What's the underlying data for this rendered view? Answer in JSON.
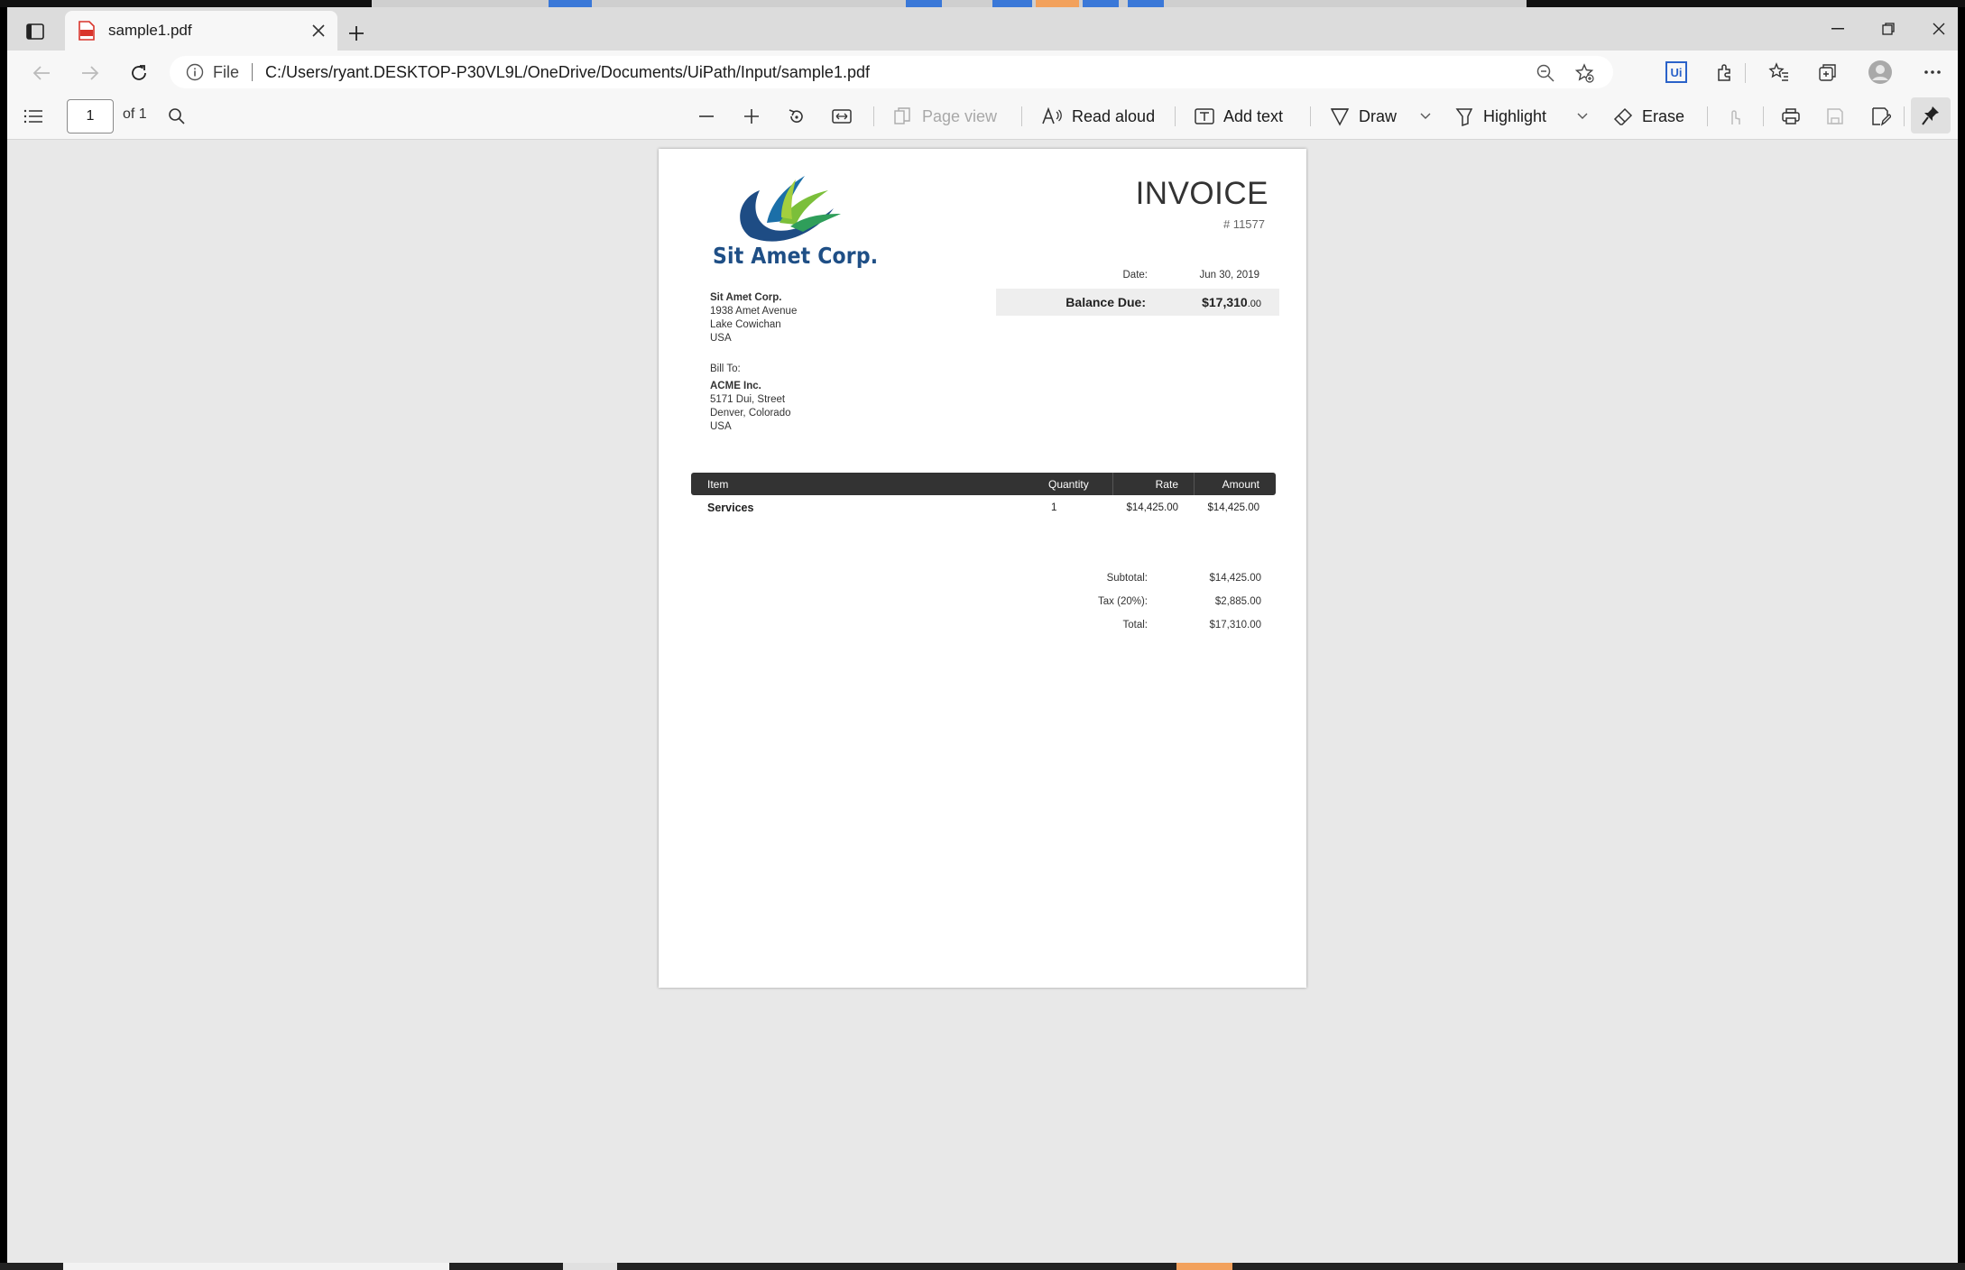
{
  "colors": {
    "accent": "#1f4f86",
    "pdf_red": "#d9342b",
    "table_header": "#333333"
  },
  "browser": {
    "tab_title": "sample1.pdf",
    "address_scheme": "File",
    "address_url": "C:/Users/ryant.DESKTOP-P30VL9L/OneDrive/Documents/UiPath/Input/sample1.pdf",
    "extension_badge": "Ui"
  },
  "pdf_toolbar": {
    "page_number": "1",
    "page_of": "of 1",
    "page_view": "Page view",
    "read_aloud": "Read aloud",
    "add_text": "Add text",
    "draw": "Draw",
    "highlight": "Highlight",
    "erase": "Erase"
  },
  "invoice": {
    "logo_text": "Sit Amet Corp.",
    "title": "INVOICE",
    "number": "# 11577",
    "date_label": "Date:",
    "date_value": "Jun 30, 2019",
    "balance_label": "Balance Due:",
    "balance_main": "$17,310",
    "balance_cents": ".00",
    "from": {
      "name": "Sit Amet Corp.",
      "line1": "1938 Amet Avenue",
      "line2": "Lake Cowichan",
      "line3": "USA"
    },
    "bill_to_label": "Bill To:",
    "bill_to": {
      "name": "ACME Inc.",
      "line1": "5171 Dui, Street",
      "line2": "Denver, Colorado",
      "line3": "USA"
    },
    "table_headers": {
      "item": "Item",
      "quantity": "Quantity",
      "rate": "Rate",
      "amount": "Amount"
    },
    "rows": [
      {
        "item": "Services",
        "quantity": "1",
        "rate": "$14,425.00",
        "amount": "$14,425.00"
      }
    ],
    "subtotal_label": "Subtotal:",
    "subtotal_value": "$14,425.00",
    "tax_label": "Tax (20%):",
    "tax_value": "$2,885.00",
    "total_label": "Total:",
    "total_value": "$17,310.00"
  }
}
